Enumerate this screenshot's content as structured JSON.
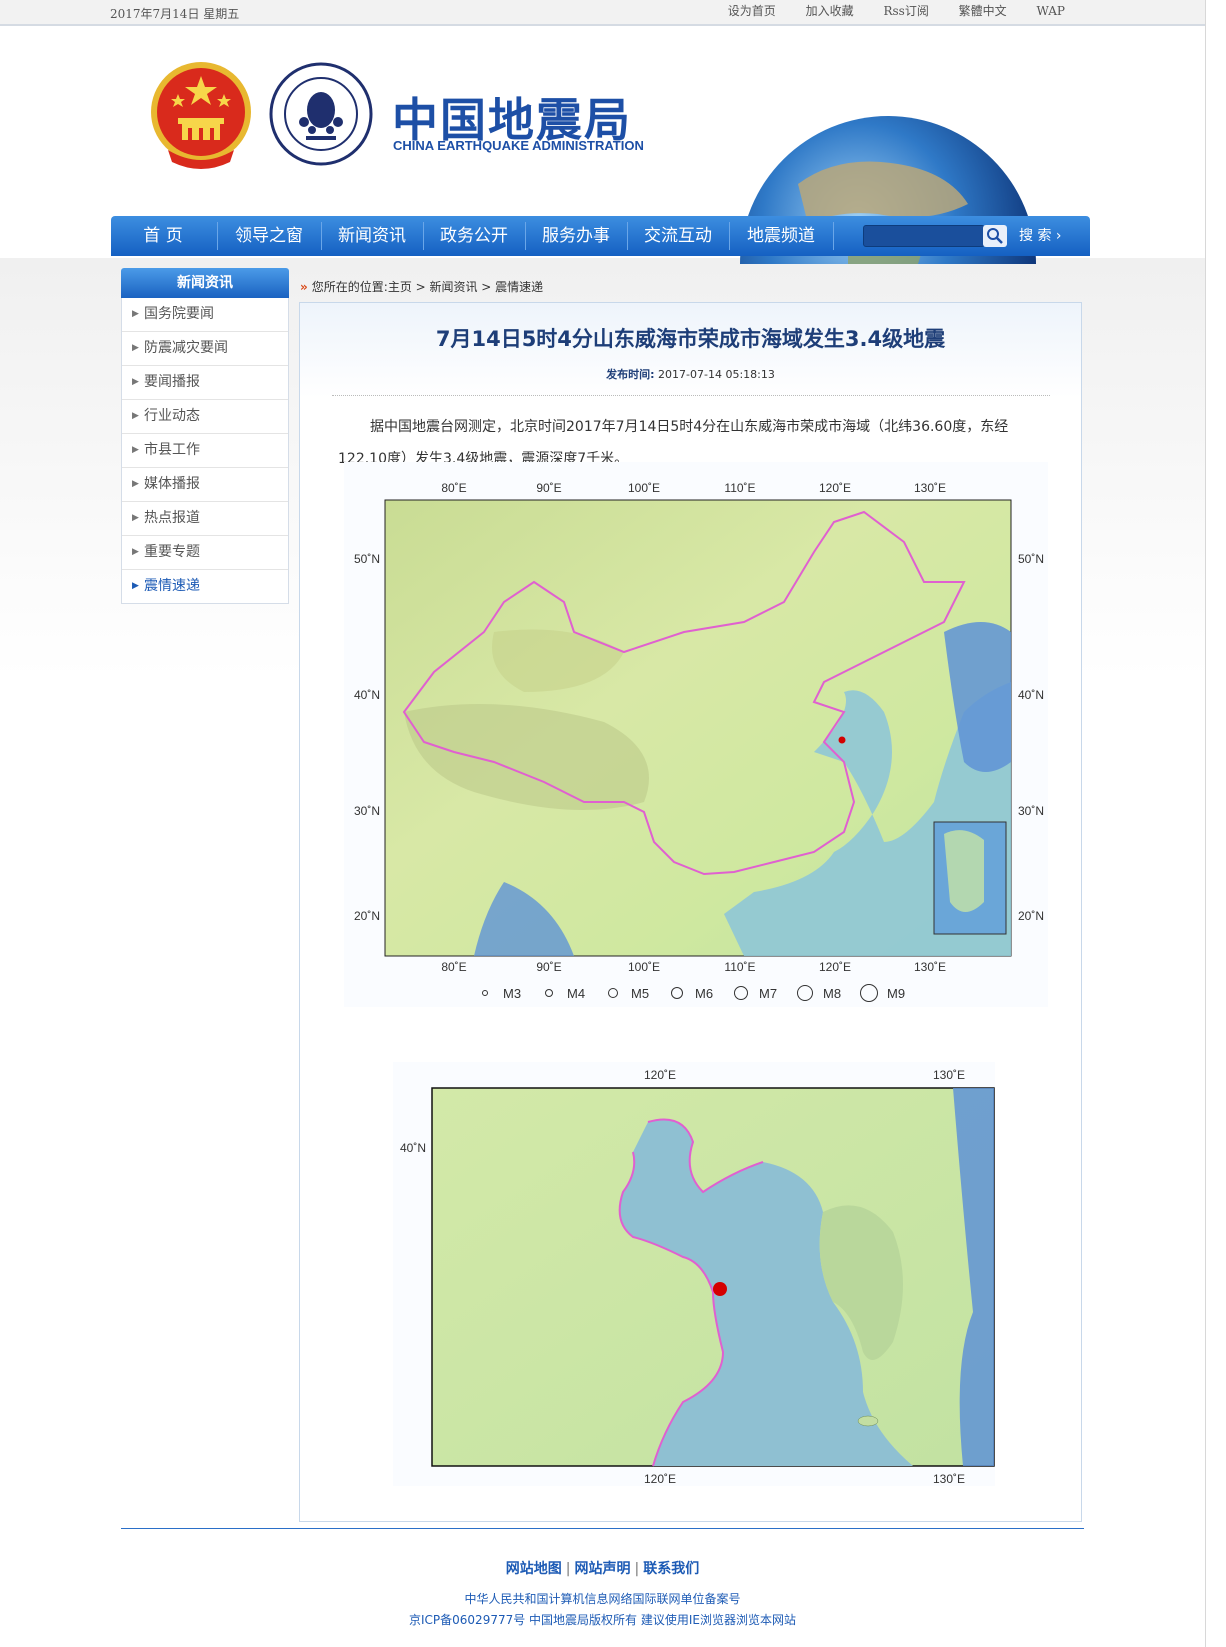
{
  "topbar": {
    "date": "2017年7月14日  星期五",
    "links": [
      "设为首页",
      "加入收藏",
      "Rss订阅",
      "繁體中文",
      "WAP"
    ]
  },
  "header": {
    "title": "中国地震局",
    "subtitle": "CHINA EARTHQUAKE ADMINISTRATION",
    "seal_text_top": "CHINA EARTHQUAKE ADMINISTRATION",
    "seal_text_bottom": "中国地震局"
  },
  "nav": {
    "items": [
      "首  页",
      "领导之窗",
      "新闻资讯",
      "政务公开",
      "服务办事",
      "交流互动",
      "地震频道"
    ],
    "search_label": "搜  索 ›"
  },
  "sidebar": {
    "title": "新闻资讯",
    "items": [
      "国务院要闻",
      "防震减灾要闻",
      "要闻播报",
      "行业动态",
      "市县工作",
      "媒体播报",
      "热点报道",
      "重要专题",
      "震情速递"
    ],
    "active": "震情速递"
  },
  "breadcrumb": {
    "prefix": "您所在的位置:",
    "path": "主页 > 新闻资讯 > 震情速递"
  },
  "article": {
    "title": "7月14日5时4分山东威海市荣成市海域发生3.4级地震",
    "pubtime_label": "发布时间:",
    "pubtime": "2017-07-14 05:18:13",
    "body": "据中国地震台网测定，北京时间2017年7月14日5时4分在山东威海市荣成市海域（北纬36.60度，东经122.10度）发生3.4级地震，震源深度7千米。"
  },
  "map1": {
    "lon_ticks": [
      "80˚E",
      "90˚E",
      "100˚E",
      "110˚E",
      "120˚E",
      "130˚E"
    ],
    "lat_ticks": [
      "50˚N",
      "40˚N",
      "30˚N",
      "20˚N"
    ],
    "legend": [
      "M3",
      "M4",
      "M5",
      "M6",
      "M7",
      "M8",
      "M9"
    ]
  },
  "map2": {
    "lon_ticks": [
      "120˚E",
      "130˚E"
    ],
    "lat_ticks": [
      "40˚N"
    ]
  },
  "footer": {
    "links": [
      "网站地图",
      "网站声明",
      "联系我们"
    ],
    "line1": "中华人民共和国计算机信息网络国际联网单位备案号",
    "line2": "京ICP备06029777号  中国地震局版权所有  建议使用IE浏览器浏览本网站"
  },
  "colors": {
    "brand_blue": "#1d4fa6",
    "nav_blue": "#1560c2",
    "epicenter": "#d40000",
    "border_pink": "#e060d0"
  }
}
